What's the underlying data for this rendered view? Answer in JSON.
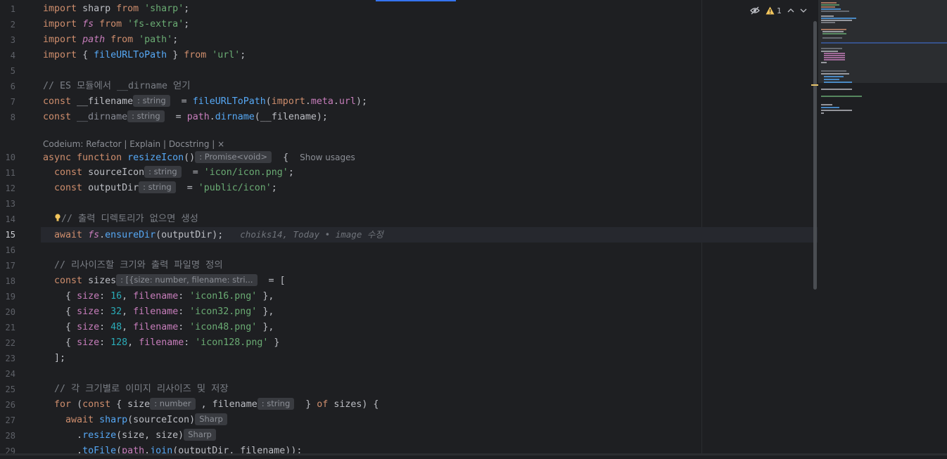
{
  "window": {
    "current_line": "15"
  },
  "inspection": {
    "warning_count": "1"
  },
  "code_lens": {
    "text": "Codeium: Refactor | Explain | Docstring | ×"
  },
  "line_numbers": [
    "1",
    "2",
    "3",
    "4",
    "5",
    "6",
    "7",
    "8",
    "",
    "10",
    "11",
    "12",
    "13",
    "14",
    "15",
    "16",
    "17",
    "18",
    "19",
    "20",
    "21",
    "22",
    "23",
    "24",
    "25",
    "26",
    "27",
    "28",
    "29"
  ],
  "lines": {
    "l1": [
      [
        "kw",
        "import"
      ],
      [
        "",
        "sharp"
      ],
      [
        "kw",
        "from"
      ],
      [
        "str",
        "'sharp'"
      ],
      [
        "",
        ";"
      ]
    ],
    "l2": [
      [
        "kw",
        "import"
      ],
      [
        "prop it",
        "fs"
      ],
      [
        "kw",
        "from"
      ],
      [
        "str",
        "'fs-extra'"
      ],
      [
        "",
        ";"
      ]
    ],
    "l3": [
      [
        "kw",
        "import"
      ],
      [
        "prop it",
        "path"
      ],
      [
        "kw",
        "from"
      ],
      [
        "str",
        "'path'"
      ],
      [
        "",
        ";"
      ]
    ],
    "l4": [
      [
        "kw",
        "import"
      ],
      [
        "",
        "{"
      ],
      [
        "fn",
        "fileURLToPath"
      ],
      [
        "",
        "}"
      ],
      [
        "kw",
        "from"
      ],
      [
        "str",
        "'url'"
      ],
      [
        "",
        ";"
      ]
    ],
    "l6": "// ES 모듈에서 __dirname 얻기",
    "l7": {
      "kw": "const",
      "name": "__filename",
      "hint": ": string",
      "eq": "=",
      "fn": "fileURLToPath",
      "open": "(",
      "imp": "import",
      "dot1": ".",
      "meta": "meta",
      "dot2": ".",
      "url": "url",
      "close": ");"
    },
    "l8": {
      "kw": "const",
      "name": "__dirname",
      "hint": ": string",
      "eq": "=",
      "obj": "path",
      "dot": ".",
      "fn": "dirname",
      "args": "(__filename);"
    },
    "l10": {
      "async": "async",
      "function": "function",
      "name": "resizeIcon",
      "parens": "()",
      "hint": ": Promise<void>",
      "brace": "{",
      "usages": "Show usages"
    },
    "l11": {
      "kw": "const",
      "name": "sourceIcon",
      "hint": ": string",
      "eq": "=",
      "val": "'icon/icon.png'",
      "end": ";"
    },
    "l12": {
      "kw": "const",
      "name": "outputDir",
      "hint": ": string",
      "eq": "=",
      "val": "'public/icon'",
      "end": ";"
    },
    "l14": "// 출력 디렉토리가 없으면 생성",
    "l15": {
      "kw": "await",
      "obj": "fs",
      "dot": ".",
      "fn": "ensureDir",
      "args": "(outputDir);",
      "blame": "choiks14, Today • image 수정"
    },
    "l17": "// 리사이즈할 크기와 출력 파일명 정의",
    "l18": {
      "kw": "const",
      "name": "sizes",
      "hint": ": [{size: number, filename: stri...",
      "rest": "= ["
    },
    "rows": [
      {
        "size": "16",
        "file": "'icon16.png'",
        "end": "},"
      },
      {
        "size": "32",
        "file": "'icon32.png'",
        "end": "},"
      },
      {
        "size": "48",
        "file": "'icon48.png'",
        "end": "},"
      },
      {
        "size": "128",
        "file": "'icon128.png'",
        "end": "}"
      }
    ],
    "row_keys": {
      "open": "{",
      "size_key": "size",
      "colon": ":",
      "comma": ",",
      "file_key": "filename"
    },
    "l23": "];",
    "l25": "// 각 크기별로 이미지 리사이즈 및 저장",
    "l26": {
      "for": "for",
      "open": "(",
      "kw": "const",
      "brace": "{",
      "size": "size",
      "hint1": ": number",
      "comma": ",",
      "filename": "filename",
      "hint2": ": string",
      "close": "}",
      "of": "of",
      "rest": "sizes) {"
    },
    "l27": {
      "kw": "await",
      "fn": "sharp",
      "args": "(sourceIcon)",
      "hint": "Sharp"
    },
    "l28": {
      "dot": ".",
      "fn": "resize",
      "args": "(size, size)",
      "hint": "Sharp"
    },
    "l29": {
      "dot": ".",
      "fn": "toFile",
      "open": "(",
      "obj": "path",
      "dot2": ".",
      "fn2": "join",
      "args": "(outputDir, filename));"
    }
  },
  "colors": {
    "background": "#1e1f22",
    "keyword": "#cf8e6d",
    "string": "#6aab73",
    "number": "#2aacb8",
    "function": "#56a8f5",
    "property": "#c77dbb",
    "comment": "#7a7e85"
  }
}
